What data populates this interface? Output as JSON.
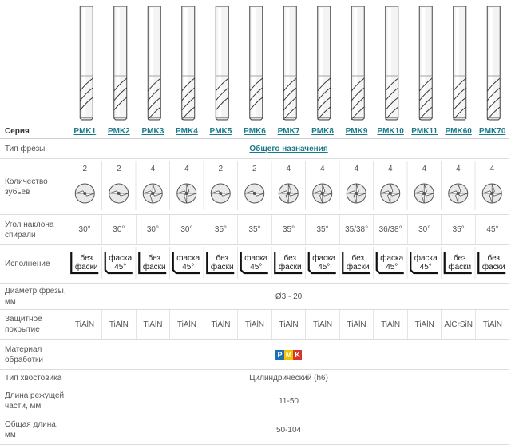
{
  "series_label": "Серия",
  "series": [
    "PMK1",
    "PMK2",
    "PMK3",
    "PMK4",
    "PMK5",
    "PMK6",
    "PMK7",
    "PMK8",
    "PMK9",
    "PMK10",
    "PMK11",
    "PMK60",
    "PMK70"
  ],
  "rows": {
    "type": {
      "label": "Тип фрезы",
      "value": "Общего назначения"
    },
    "teeth": {
      "label": "Количество зубьев",
      "values": [
        "2",
        "2",
        "4",
        "4",
        "2",
        "2",
        "4",
        "4",
        "4",
        "4",
        "4",
        "4",
        "4"
      ]
    },
    "helix": {
      "label": "Угол наклона спирали",
      "values": [
        "30°",
        "30°",
        "30°",
        "30°",
        "35°",
        "35°",
        "35°",
        "35°",
        "35/38°",
        "36/38°",
        "30°",
        "35°",
        "45°"
      ]
    },
    "edge": {
      "label": "Исполнение",
      "values": [
        "без фаски",
        "фаска 45°",
        "без фаски",
        "фаска 45°",
        "без фаски",
        "фаска 45°",
        "без фаски",
        "фаска 45°",
        "без фаски",
        "фаска 45°",
        "фаска 45°",
        "без фаски",
        "без фаски"
      ]
    },
    "diameter": {
      "label": "Диаметр фрезы, мм",
      "value": "Ø3 - 20"
    },
    "coating": {
      "label": "Защитное покрытие",
      "values": [
        "TiAlN",
        "TiAlN",
        "TiAlN",
        "TiAlN",
        "TiAlN",
        "TiAlN",
        "TiAlN",
        "TiAlN",
        "TiAlN",
        "TiAlN",
        "TiAlN",
        "AlCrSiN",
        "TiAlN"
      ]
    },
    "material": {
      "label": "Материал обработки",
      "letters": [
        "P",
        "M",
        "K"
      ],
      "colors": [
        "#1e6fb5",
        "#f2c200",
        "#d9342b"
      ]
    },
    "shank": {
      "label": "Тип хвостовика",
      "value": "Цилиндрический (h6)"
    },
    "cut_length": {
      "label": "Длина режущей части, мм",
      "value": "11-50"
    },
    "total_length": {
      "label": "Общая длина, мм",
      "value": "50-104"
    }
  },
  "colors": {
    "link": "#1a7a8a",
    "border": "#dcdcdc"
  }
}
